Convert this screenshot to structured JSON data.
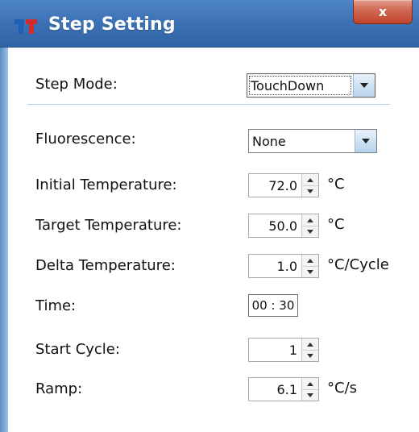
{
  "window": {
    "title": "Step Setting",
    "close_label": "x"
  },
  "form": {
    "step_mode": {
      "label": "Step Mode:",
      "value": "TouchDown"
    },
    "fluorescence": {
      "label": "Fluorescence:",
      "value": "None"
    },
    "initial_temperature": {
      "label": "Initial Temperature:",
      "value": "72.0",
      "unit": "°C"
    },
    "target_temperature": {
      "label": "Target Temperature:",
      "value": "50.0",
      "unit": "°C"
    },
    "delta_temperature": {
      "label": "Delta Temperature:",
      "value": "1.0",
      "unit": "°C/Cycle"
    },
    "time": {
      "label": "Time:",
      "value": "00 : 30"
    },
    "start_cycle": {
      "label": "Start Cycle:",
      "value": "1"
    },
    "ramp": {
      "label": "Ramp:",
      "value": "6.1",
      "unit": "°C/s"
    }
  },
  "icons": {
    "app_logo": "app-logo-icon",
    "dropdown": "chevron-down-icon",
    "spin_up": "spin-up-icon",
    "spin_down": "spin-down-icon"
  },
  "colors": {
    "titlebar": "#3d73b6",
    "close_button": "#c0452d",
    "logo_blue": "#1f5fb5",
    "logo_red": "#d42b2b"
  }
}
